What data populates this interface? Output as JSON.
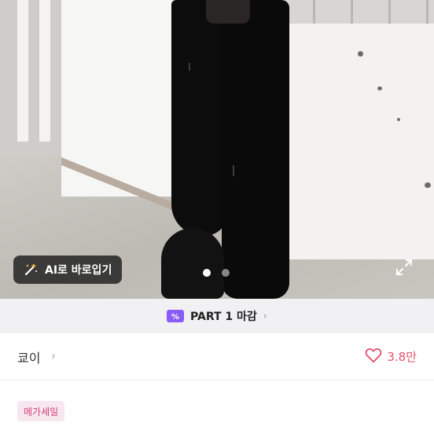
{
  "photo": {
    "alt_icon": "product-photo",
    "ai_button_label": "AI로 바로입기",
    "ai_icon": "magic-wand-icon",
    "page_dots": [
      true,
      false
    ],
    "expand_icon": "expand-icon"
  },
  "banner": {
    "label": "PART 1 마감",
    "icon": "ticket-icon"
  },
  "seller": {
    "name": "쿄이",
    "like_count": "3.8만",
    "heart_color": "#e2536a"
  },
  "tags": {
    "sale": "메가세일"
  },
  "colors": {
    "accent": "#8a5cf6",
    "tag_bg": "#f7e8ef",
    "tag_text": "#d23f74"
  }
}
